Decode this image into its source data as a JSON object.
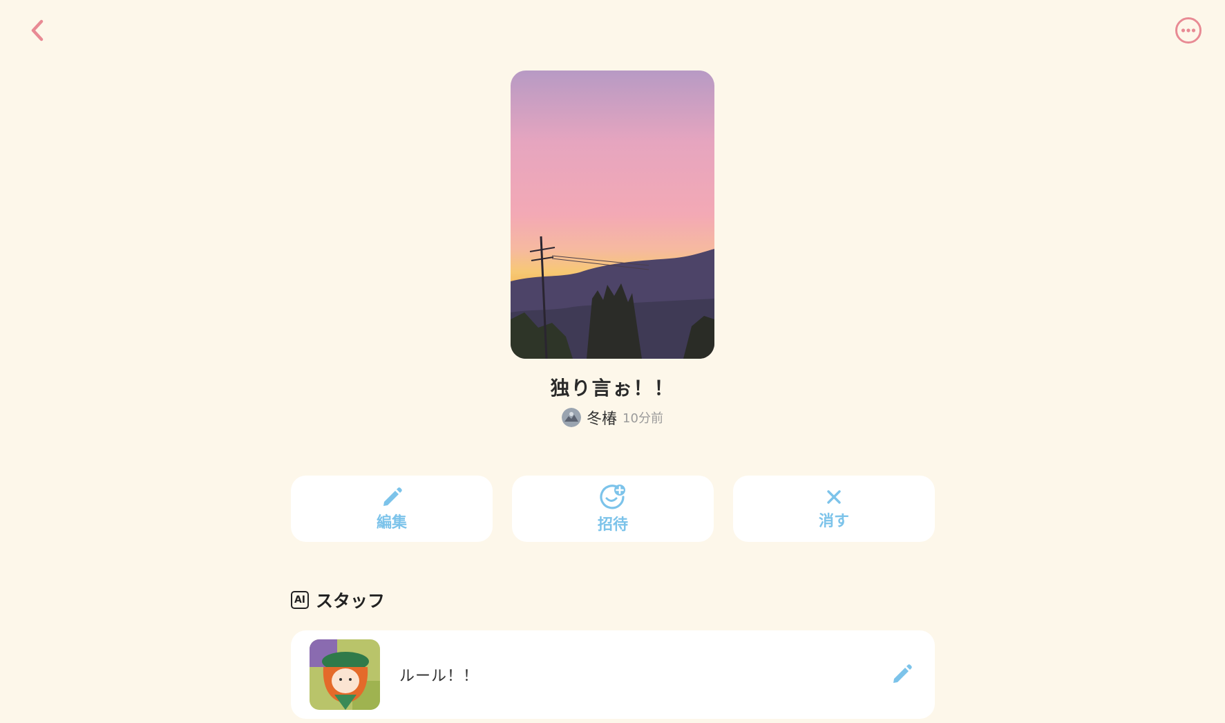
{
  "nav": {
    "back_icon": "chevron-left-icon",
    "more_icon": "more-horizontal-icon",
    "accent_color": "#e88a94"
  },
  "room": {
    "title": "独り言ぉ！！",
    "author": "冬椿",
    "time_ago": "10分前"
  },
  "actions": [
    {
      "icon": "pencil-icon",
      "label": "編集"
    },
    {
      "icon": "invite-icon",
      "label": "招待"
    },
    {
      "icon": "close-icon",
      "label": "消す"
    }
  ],
  "action_color": "#7cc3ea",
  "staff_section": {
    "badge": "AI",
    "title": "スタッフ",
    "items": [
      {
        "name": "ルール！！",
        "edit_icon": "pencil-icon"
      }
    ]
  }
}
